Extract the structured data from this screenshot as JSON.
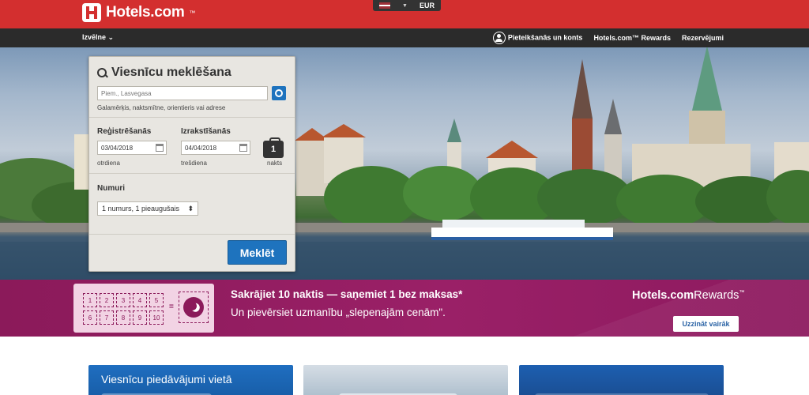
{
  "header": {
    "brand": "Hotels.com",
    "brand_tm": "™",
    "currency": "EUR",
    "currency_arrow": "▼",
    "flag_icon": "latvia-flag-icon"
  },
  "nav": {
    "choose": "Izvēlne ⌄",
    "signin": "Pieteikšanās un konts",
    "rewards": "Hotels.com™ Rewards",
    "bookings": "Rezervējumi"
  },
  "search": {
    "title": "Viesnīcu meklēšana",
    "destination_placeholder": "Piem., Lasvegasa",
    "destination_hint": "Galamērķis, naktsmītne, orientieris vai adrese",
    "checkin_label": "Reģistrēšanās",
    "checkin_value": "03/04/2018",
    "checkin_day": "otrdiena",
    "checkout_label": "Izrakstīšanās",
    "checkout_value": "04/04/2018",
    "checkout_day": "trešdiena",
    "nights_count": "1",
    "nights_label": "nakts",
    "rooms_label": "Numuri",
    "rooms_value": "1 numurs, 1 pieaugušais",
    "rooms_arrow": "⬍",
    "search_button": "Meklēt"
  },
  "rewards": {
    "stamps_row1": [
      "1",
      "2",
      "3",
      "4",
      "5"
    ],
    "stamps_row2": [
      "6",
      "7",
      "8",
      "9",
      "10"
    ],
    "equals": "=",
    "title": "Sakrājiet 10 naktis — saņemiet 1 bez maksas*",
    "subtitle": "Un pievērsiet uzmanību „slepenajām cenām\".",
    "logo_main": "Hotels.com",
    "logo_sub": "Rewards",
    "logo_tm": "™",
    "button": "Uzzināt vairāk"
  },
  "cards": {
    "card1_title": "Viesnīcu piedāvājumi vietā"
  },
  "colors": {
    "brand_red": "#d32f2f",
    "nav_dark": "#2b2b2b",
    "primary_blue": "#1e73be",
    "rewards_purple": "#8b1a5a"
  }
}
